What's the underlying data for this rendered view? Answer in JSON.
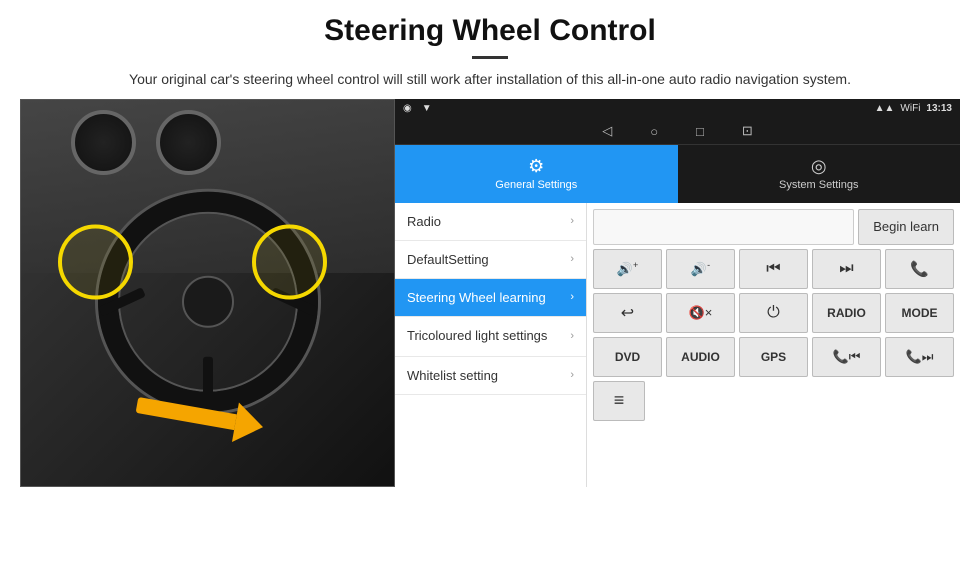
{
  "page": {
    "title": "Steering Wheel Control",
    "divider": true,
    "subtitle": "Your original car's steering wheel control will still work after installation of this all-in-one auto radio navigation system."
  },
  "status_bar": {
    "time": "13:13",
    "location_icon": "◉",
    "signal_icon": "▲",
    "wifi_icon": "▼"
  },
  "nav_bar": {
    "back_icon": "◁",
    "home_icon": "○",
    "recent_icon": "□",
    "screenshot_icon": "⊡"
  },
  "tabs": [
    {
      "id": "general",
      "label": "General Settings",
      "icon": "⚙",
      "active": true
    },
    {
      "id": "system",
      "label": "System Settings",
      "icon": "◎",
      "active": false
    }
  ],
  "menu_items": [
    {
      "id": "radio",
      "label": "Radio",
      "active": false
    },
    {
      "id": "defaultsetting",
      "label": "DefaultSetting",
      "active": false
    },
    {
      "id": "steering",
      "label": "Steering Wheel learning",
      "active": true
    },
    {
      "id": "tricoloured",
      "label": "Tricoloured light settings",
      "active": false
    },
    {
      "id": "whitelist",
      "label": "Whitelist setting",
      "active": false
    }
  ],
  "controls": {
    "begin_learn_label": "Begin learn",
    "row1": [
      {
        "id": "vol-up",
        "symbol": "🔊+",
        "label": "vol-up"
      },
      {
        "id": "vol-down",
        "symbol": "🔊-",
        "label": "vol-down"
      },
      {
        "id": "prev-track",
        "symbol": "⏮",
        "label": "prev-track"
      },
      {
        "id": "next-track",
        "symbol": "⏭",
        "label": "next-track"
      },
      {
        "id": "phone",
        "symbol": "📞",
        "label": "phone"
      }
    ],
    "row2": [
      {
        "id": "hang-up",
        "symbol": "↩",
        "label": "hang-up"
      },
      {
        "id": "mute",
        "symbol": "🔇×",
        "label": "mute"
      },
      {
        "id": "power",
        "symbol": "⏻",
        "label": "power"
      },
      {
        "id": "radio-btn",
        "symbol": "RADIO",
        "label": "radio-btn"
      },
      {
        "id": "mode",
        "symbol": "MODE",
        "label": "mode"
      }
    ],
    "row3": [
      {
        "id": "dvd",
        "symbol": "DVD",
        "label": "dvd"
      },
      {
        "id": "audio",
        "symbol": "AUDIO",
        "label": "audio"
      },
      {
        "id": "gps",
        "symbol": "GPS",
        "label": "gps"
      },
      {
        "id": "tel-prev",
        "symbol": "📞⏮",
        "label": "tel-prev"
      },
      {
        "id": "tel-next",
        "symbol": "📞⏭",
        "label": "tel-next"
      }
    ],
    "row4": [
      {
        "id": "list-icon",
        "symbol": "≡",
        "label": "list-icon"
      }
    ]
  }
}
